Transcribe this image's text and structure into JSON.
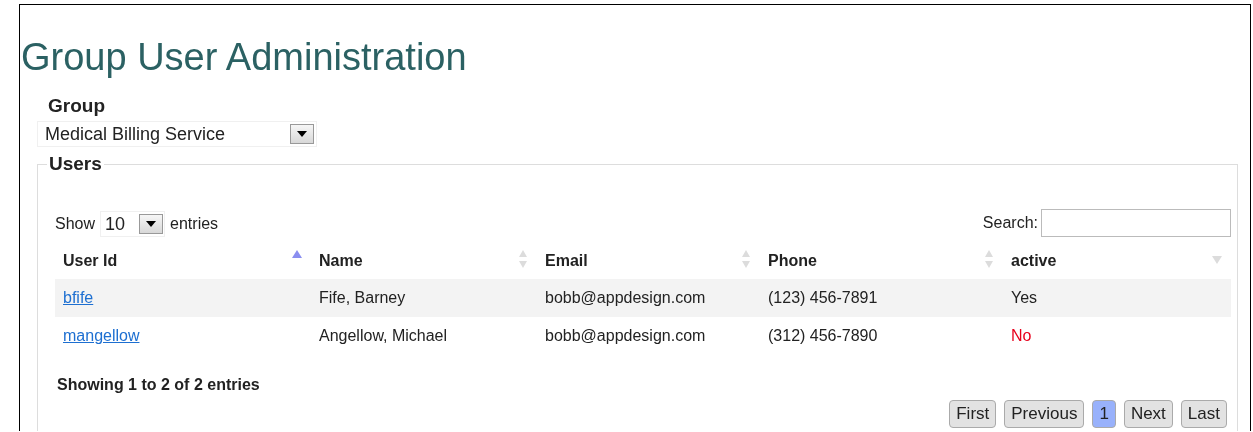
{
  "title": "Group User Administration",
  "group": {
    "label": "Group",
    "value": "Medical Billing Service"
  },
  "users": {
    "legend": "Users",
    "length": {
      "before": "Show",
      "value": "10",
      "after": "entries"
    },
    "search": {
      "label": "Search:"
    },
    "columns": [
      {
        "label": "User Id",
        "kind": "ascending"
      },
      {
        "label": "Name",
        "kind": "sortable"
      },
      {
        "label": "Email",
        "kind": "sortable"
      },
      {
        "label": "Phone",
        "kind": "sortable"
      },
      {
        "label": "active",
        "kind": "inactive"
      }
    ],
    "rows": [
      {
        "user_id": "bfife",
        "name": "Fife, Barney",
        "email": "bobb@appdesign.com",
        "phone": "(123) 456-7891",
        "active_text": "Yes",
        "active": true
      },
      {
        "user_id": "mangellow",
        "name": "Angellow, Michael",
        "email": "bobb@appdesign.com",
        "phone": "(312) 456-7890",
        "active_text": "No",
        "active": false
      }
    ],
    "info": "Showing 1 to 2 of 2 entries",
    "pagination": [
      {
        "label": "First",
        "selected": false
      },
      {
        "label": "Previous",
        "selected": false
      },
      {
        "label": "1",
        "selected": true
      },
      {
        "label": "Next",
        "selected": false
      },
      {
        "label": "Last",
        "selected": false
      }
    ]
  }
}
